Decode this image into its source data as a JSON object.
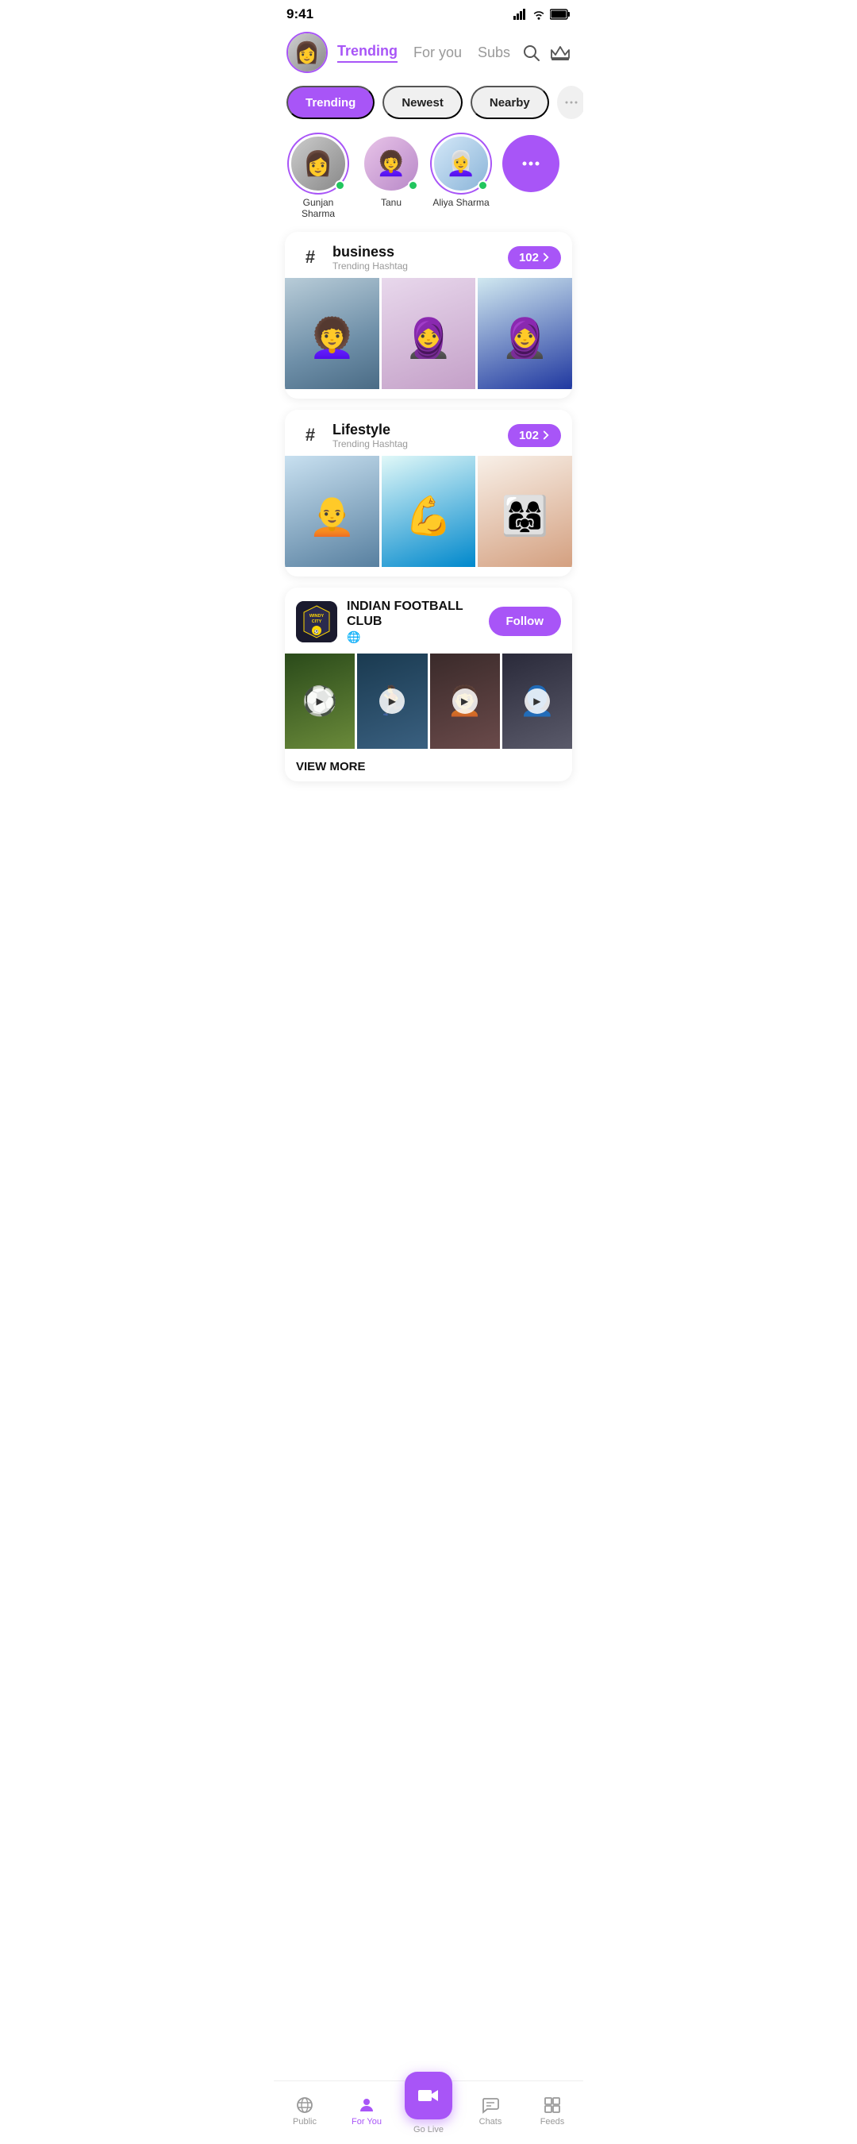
{
  "statusBar": {
    "time": "9:41",
    "signal": "▌▌▌▌",
    "wifi": "wifi",
    "battery": "battery"
  },
  "header": {
    "tabs": [
      {
        "id": "trending",
        "label": "Trending",
        "active": true
      },
      {
        "id": "for-you",
        "label": "For you",
        "active": false
      },
      {
        "id": "subs",
        "label": "Subs",
        "active": false
      }
    ],
    "searchIcon": "search",
    "crownIcon": "crown"
  },
  "filterPills": [
    {
      "id": "trending",
      "label": "Trending",
      "active": true
    },
    {
      "id": "newest",
      "label": "Newest",
      "active": false
    },
    {
      "id": "nearby",
      "label": "Nearby",
      "active": false
    }
  ],
  "stories": [
    {
      "id": 1,
      "name": "Gunjan Sharma",
      "online": true,
      "hasRing": true,
      "emoji": "👩"
    },
    {
      "id": 2,
      "name": "Tanu",
      "online": true,
      "hasRing": false,
      "emoji": "👩‍🦱"
    },
    {
      "id": 3,
      "name": "Aliya Sharma",
      "online": true,
      "hasRing": true,
      "emoji": "👩‍🦳"
    },
    {
      "id": 4,
      "name": "More",
      "isMore": true
    }
  ],
  "hashtagCards": [
    {
      "id": 1,
      "symbol": "#",
      "title": "business",
      "subtitle": "Trending Hashtag",
      "count": "102",
      "images": [
        "person-warm",
        "person-hijab",
        "person-hijab2"
      ]
    },
    {
      "id": 2,
      "symbol": "#",
      "title": "Lifestyle",
      "subtitle": "Trending Hashtag",
      "count": "102",
      "images": [
        "person-man",
        "person-athlete",
        "person-group"
      ]
    }
  ],
  "clubCard": {
    "logoText": "WINDY\nCITY\nRAMPAGE",
    "name": "INDIAN FOOTBALL CLUB",
    "typeIcon": "🌐",
    "followLabel": "Follow",
    "viewMoreLabel": "VIEW MORE",
    "videos": [
      {
        "type": "football"
      },
      {
        "type": "player"
      },
      {
        "type": "portrait"
      },
      {
        "type": "face"
      }
    ]
  },
  "bottomNav": [
    {
      "id": "public",
      "icon": "public",
      "label": "Public",
      "active": false
    },
    {
      "id": "for-you",
      "icon": "person",
      "label": "For You",
      "active": true
    },
    {
      "id": "go-live",
      "icon": "video",
      "label": "Go Live",
      "isCenter": true
    },
    {
      "id": "chats",
      "icon": "chat",
      "label": "Chats",
      "active": false
    },
    {
      "id": "feeds",
      "icon": "feeds",
      "label": "Feeds",
      "active": false
    }
  ]
}
